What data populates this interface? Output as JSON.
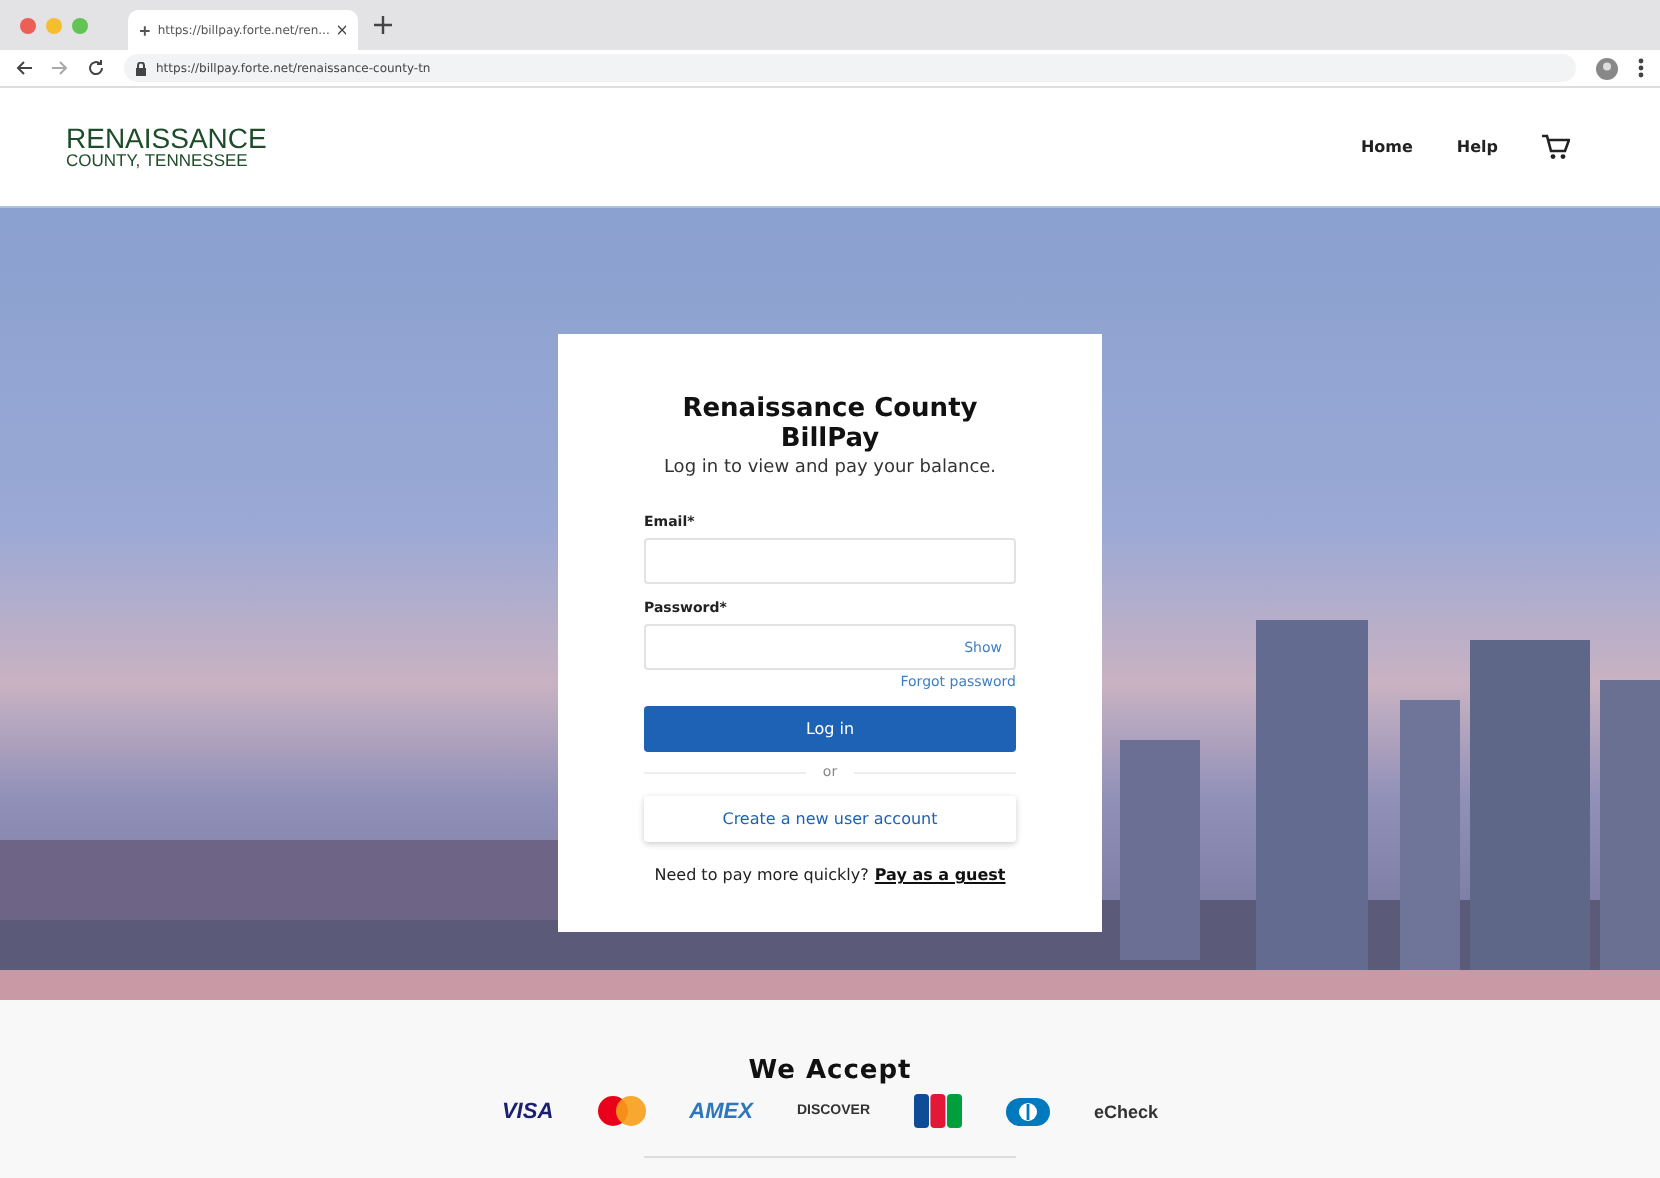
{
  "browser": {
    "tab_title": "https://billpay.forte.net/ren...",
    "address": "https://billpay.forte.net/renaissance-county-tn"
  },
  "header": {
    "logo_line1": "RENAISSANCE",
    "logo_line2": "COUNTY, TENNESSEE",
    "nav": [
      "Home",
      "Help"
    ]
  },
  "login": {
    "title": "Renaissance County BillPay",
    "subtitle": "Log in to view and pay your balance.",
    "email_label": "Email*",
    "password_label": "Password*",
    "show": "Show",
    "forgot": "Forgot password",
    "login_button": "Log in",
    "divider": "or",
    "create_button": "Create a new user account",
    "guest_prompt": "Need to pay more quickly?",
    "guest_link": "Pay as a guest"
  },
  "footer": {
    "title": "We Accept",
    "methods": [
      {
        "kind": "text",
        "text": "VISA"
      },
      {
        "kind": "mastercard"
      },
      {
        "kind": "text",
        "text": "AMEX"
      },
      {
        "kind": "text",
        "text": "DISCOVER"
      },
      {
        "kind": "jcb"
      },
      {
        "kind": "diners"
      },
      {
        "kind": "text",
        "text": "eCheck"
      }
    ]
  }
}
